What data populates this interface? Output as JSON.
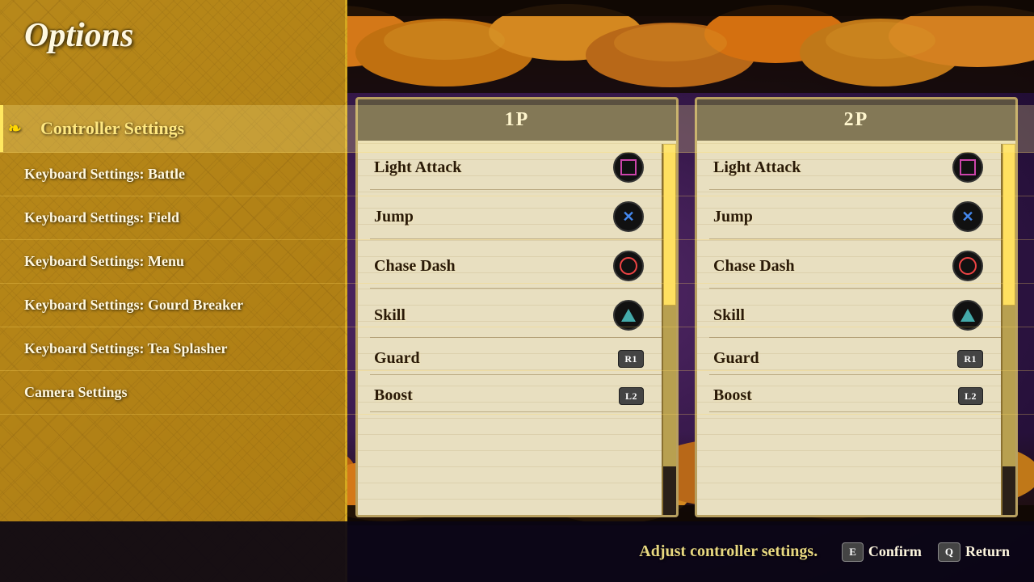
{
  "page": {
    "title": "Options",
    "bg_hint": "Adjust controller settings.",
    "confirm_label": "Confirm",
    "return_label": "Return",
    "confirm_key": "E",
    "return_key": "Q"
  },
  "nav": {
    "active": "Controller Settings",
    "items": [
      {
        "label": "Controller Settings",
        "active": true
      },
      {
        "label": "Keyboard Settings: Battle",
        "active": false
      },
      {
        "label": "Keyboard Settings: Field",
        "active": false
      },
      {
        "label": "Keyboard Settings: Menu",
        "active": false
      },
      {
        "label": "Keyboard Settings: Gourd Breaker",
        "active": false
      },
      {
        "label": "Keyboard Settings: Tea Splasher",
        "active": false
      },
      {
        "label": "Camera Settings",
        "active": false
      }
    ]
  },
  "panels": [
    {
      "id": "1p",
      "header": "1P",
      "bindings": [
        {
          "name": "Light Attack",
          "button": "square",
          "label": ""
        },
        {
          "name": "Jump",
          "button": "cross",
          "label": ""
        },
        {
          "name": "Chase Dash",
          "button": "circle",
          "label": ""
        },
        {
          "name": "Skill",
          "button": "triangle",
          "label": ""
        },
        {
          "name": "Guard",
          "button": "r1",
          "label": "R1"
        },
        {
          "name": "Boost",
          "button": "l2",
          "label": "L2"
        }
      ]
    },
    {
      "id": "2p",
      "header": "2P",
      "bindings": [
        {
          "name": "Light Attack",
          "button": "square",
          "label": ""
        },
        {
          "name": "Jump",
          "button": "cross",
          "label": ""
        },
        {
          "name": "Chase Dash",
          "button": "circle",
          "label": ""
        },
        {
          "name": "Skill",
          "button": "triangle",
          "label": ""
        },
        {
          "name": "Guard",
          "button": "r1",
          "label": "R1"
        },
        {
          "name": "Boost",
          "button": "l2",
          "label": "L2"
        }
      ]
    }
  ]
}
